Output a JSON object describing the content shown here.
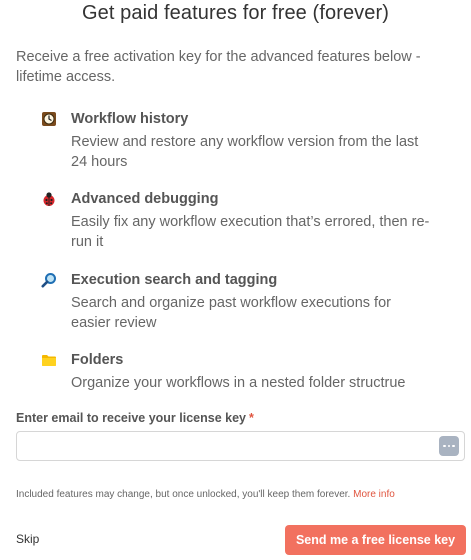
{
  "modal": {
    "title": "Get paid features for free (forever)",
    "intro": "Receive a free activation key for the advanced features below - lifetime access."
  },
  "features": [
    {
      "icon": "clock-icon",
      "title": "Workflow history",
      "description": "Review and restore any workflow version from the last 24 hours"
    },
    {
      "icon": "ladybug-icon",
      "title": "Advanced debugging",
      "description": "Easily fix any workflow execution that’s errored, then re-run it"
    },
    {
      "icon": "magnifier-icon",
      "title": "Execution search and tagging",
      "description": "Search and organize past workflow executions for easier review"
    },
    {
      "icon": "folder-icon",
      "title": "Folders",
      "description": "Organize your workflows in a nested folder structrue"
    }
  ],
  "email": {
    "label": "Enter email to receive your license key",
    "required_mark": "*",
    "value": "",
    "placeholder": ""
  },
  "note": {
    "text": "Included features may change, but once unlocked, you'll keep them forever.",
    "link": "More info"
  },
  "actions": {
    "skip_label": "Skip",
    "submit_label": "Send me a free license key"
  },
  "colors": {
    "accent": "#f2715f",
    "link": "#e0553f"
  }
}
